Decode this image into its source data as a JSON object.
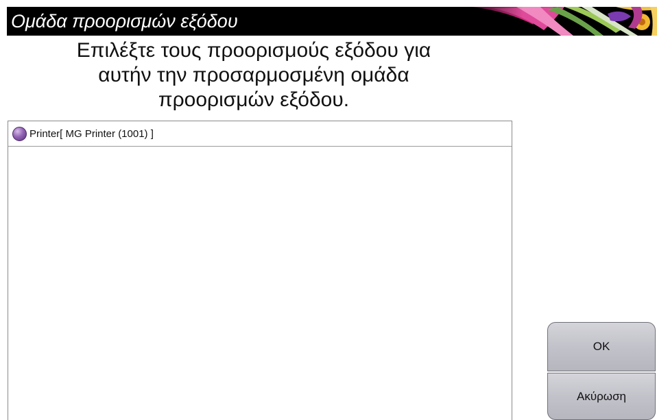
{
  "window": {
    "title": "Ομάδα προορισμών εξόδου"
  },
  "instructions": "Επιλέξτε τους προορισμούς εξόδου για\nαυτήν την προσαρμοσμένη ομάδα\nπροορισμών εξόδου.",
  "destinations": [
    {
      "label": "Printer[ MG Printer (1001) ]",
      "icon": "radio-unselected-icon",
      "icon_color": "#8a5aa8"
    }
  ],
  "buttons": {
    "ok_label": "OK",
    "cancel_label": "Ακύρωση"
  },
  "colors": {
    "title_bar": "#000000",
    "title_text": "#ffffff",
    "button_face": "#c4c4cc"
  }
}
